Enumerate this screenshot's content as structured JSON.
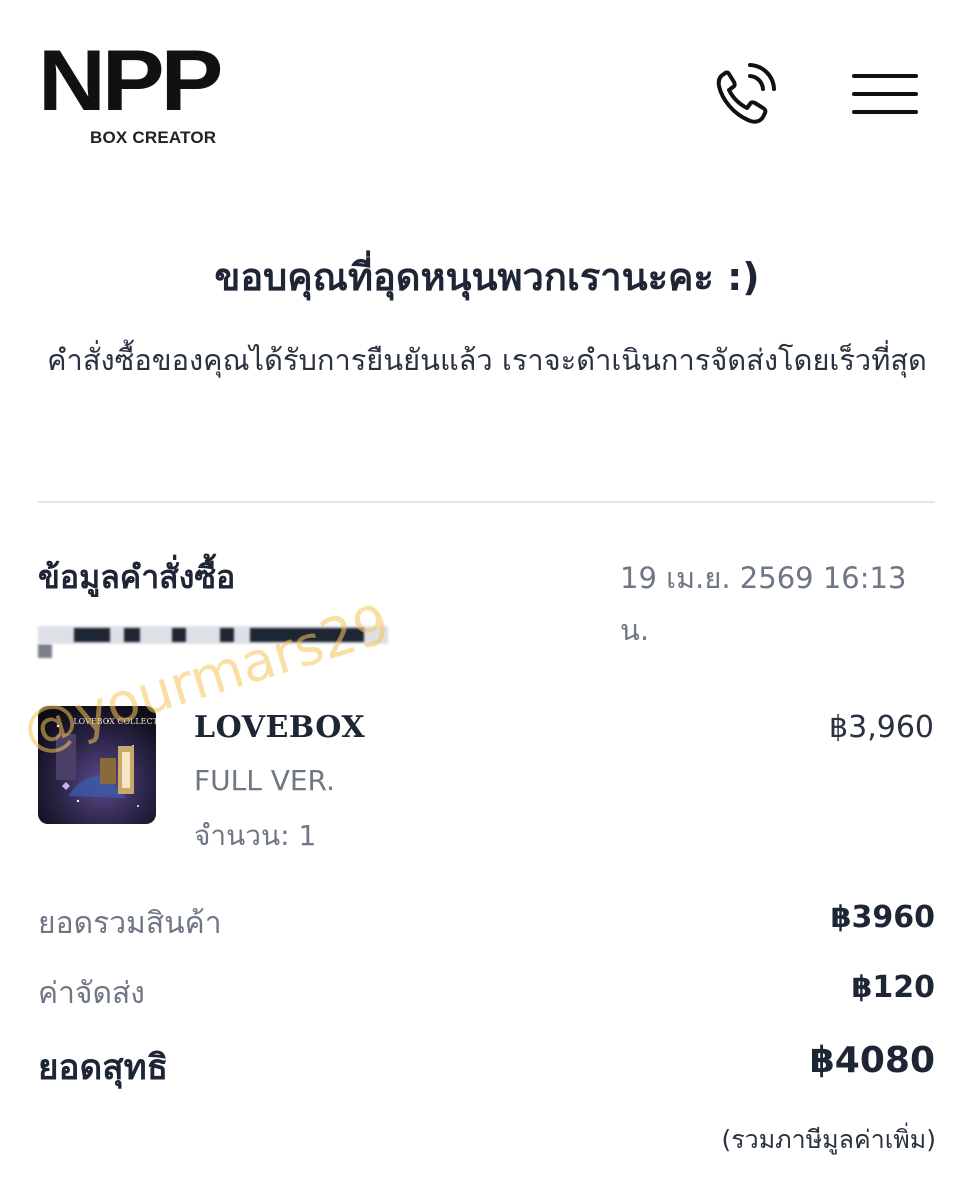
{
  "header": {
    "logo_text": "NPP",
    "logo_subtitle": "BOX CREATOR"
  },
  "thanks": {
    "title": "ขอบคุณที่อุดหนุนพวกเรานะคะ :)",
    "message": "คำสั่งซื้อของคุณได้รับการยืนยันแล้ว เราจะดำเนินการจัดส่งโดยเร็วที่สุด"
  },
  "order": {
    "heading": "ข้อมูลคำสั่งซื้อ",
    "date": "19 เม.ย. 2569 16:13 น."
  },
  "item": {
    "name": "LOVEBOX",
    "variant": "FULL VER.",
    "quantity": "จำนวน: 1",
    "price": "฿3,960",
    "image_text": "LOVEBOX COLLECTION"
  },
  "watermark": "@yourmars29",
  "summary": {
    "subtotal_label": "ยอดรวมสินค้า",
    "subtotal_value": "฿3960",
    "shipping_label": "ค่าจัดส่ง",
    "shipping_value": "฿120",
    "total_label": "ยอดสุทธิ",
    "total_value": "฿4080",
    "tax_note": "(รวมภาษีมูลค่าเพิ่ม)"
  },
  "colors": {
    "text_primary": "#1e2636",
    "text_secondary": "#6f7684",
    "divider": "#e4e6ea",
    "watermark": "#f5c45a"
  }
}
